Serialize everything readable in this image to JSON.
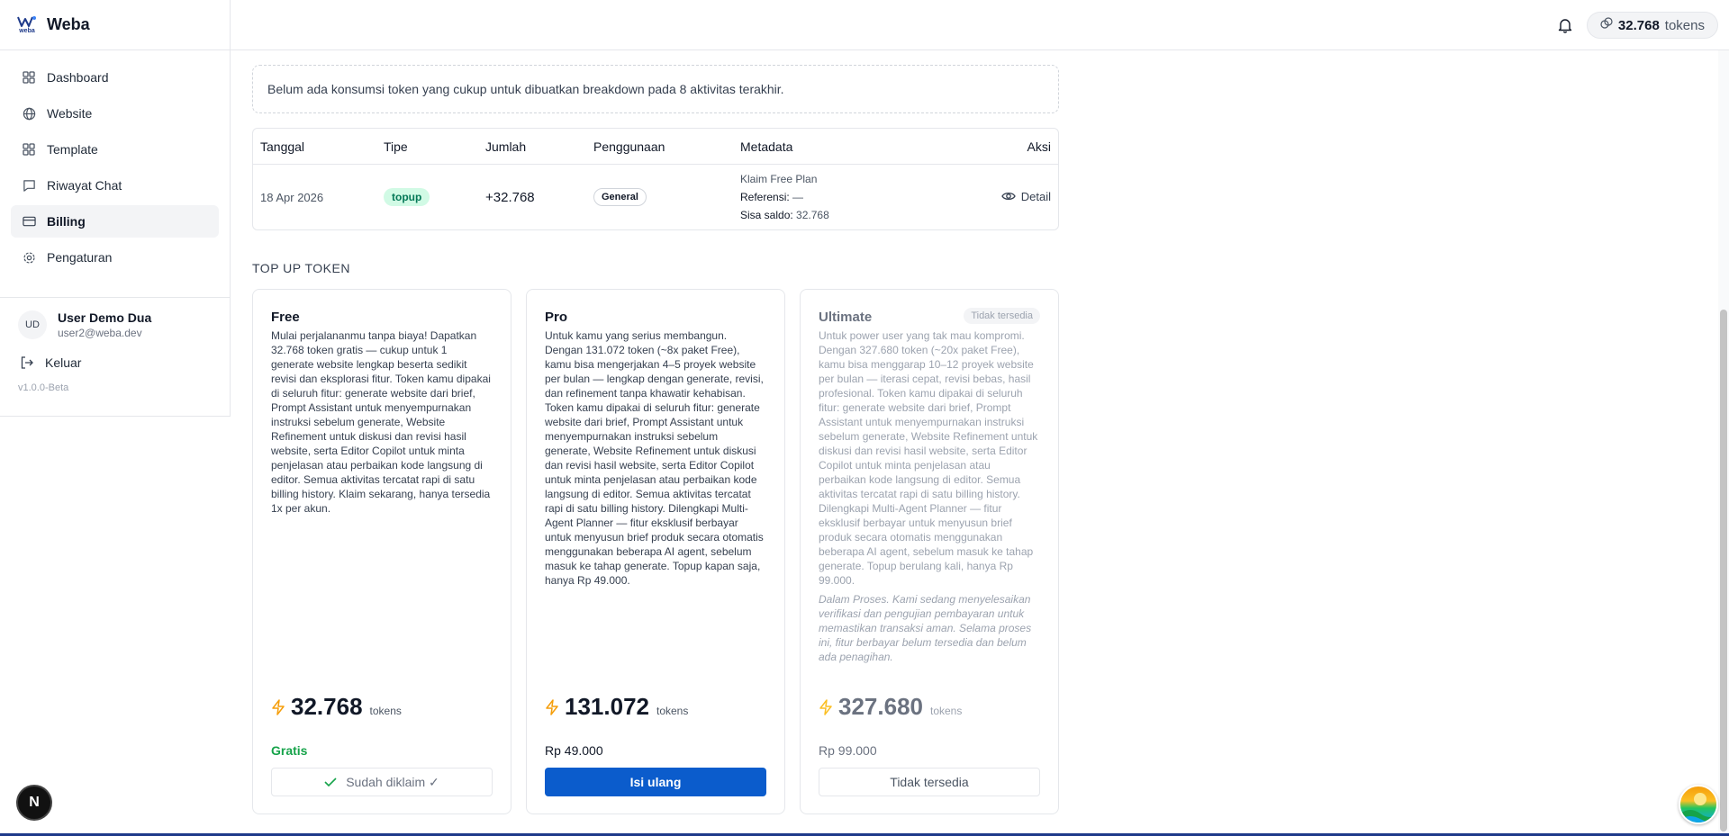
{
  "brand": {
    "name": "Weba",
    "logo_text": "weba"
  },
  "nav": [
    {
      "label": "Dashboard",
      "icon": "grid-icon"
    },
    {
      "label": "Website",
      "icon": "globe-icon"
    },
    {
      "label": "Template",
      "icon": "grid-icon"
    },
    {
      "label": "Riwayat Chat",
      "icon": "chat-icon"
    },
    {
      "label": "Billing",
      "icon": "card-icon",
      "active": true
    },
    {
      "label": "Pengaturan",
      "icon": "gear-icon"
    }
  ],
  "user": {
    "initials": "UD",
    "name": "User Demo Dua",
    "email": "user2@weba.dev"
  },
  "logout_label": "Keluar",
  "version": "v1.0.0-Beta",
  "header": {
    "token_amount": "32.768",
    "token_unit": "tokens"
  },
  "empty_note": "Belum ada konsumsi token yang cukup untuk dibuatkan breakdown pada 8 aktivitas terakhir.",
  "table": {
    "headers": [
      "Tanggal",
      "Tipe",
      "Jumlah",
      "Penggunaan",
      "Metadata",
      "Aksi"
    ],
    "rows": [
      {
        "date": "18 Apr 2026",
        "type": "topup",
        "amount": "+32.768",
        "usage": "General",
        "meta_title": "Klaim Free Plan",
        "meta_ref_label": "Referensi:",
        "meta_ref_value": "—",
        "meta_balance_label": "Sisa saldo:",
        "meta_balance_value": "32.768",
        "action": "Detail"
      }
    ]
  },
  "section_title": "TOP UP TOKEN",
  "plans": [
    {
      "title": "Free",
      "desc": "Mulai perjalananmu tanpa biaya! Dapatkan 32.768 token gratis — cukup untuk 1 generate website lengkap beserta sedikit revisi dan eksplorasi fitur. Token kamu dipakai di seluruh fitur: generate website dari brief, Prompt Assistant untuk menyempurnakan instruksi sebelum generate, Website Refinement untuk diskusi dan revisi hasil website, serta Editor Copilot untuk minta penjelasan atau perbaikan kode langsung di editor. Semua aktivitas tercatat rapi di satu billing history. Klaim sekarang, hanya tersedia 1x per akun.",
      "tokens": "32.768",
      "unit": "tokens",
      "price": "Gratis",
      "button": "Sudah diklaim ✓"
    },
    {
      "title": "Pro",
      "desc": "Untuk kamu yang serius membangun. Dengan 131.072 token (~8x paket Free), kamu bisa mengerjakan 4–5 proyek website per bulan — lengkap dengan generate, revisi, dan refinement tanpa khawatir kehabisan. Token kamu dipakai di seluruh fitur: generate website dari brief, Prompt Assistant untuk menyempurnakan instruksi sebelum generate, Website Refinement untuk diskusi dan revisi hasil website, serta Editor Copilot untuk minta penjelasan atau perbaikan kode langsung di editor. Semua aktivitas tercatat rapi di satu billing history. Dilengkapi Multi-Agent Planner — fitur eksklusif berbayar untuk menyusun brief produk secara otomatis menggunakan beberapa AI agent, sebelum masuk ke tahap generate. Topup kapan saja, hanya Rp 49.000.",
      "tokens": "131.072",
      "unit": "tokens",
      "price": "Rp 49.000",
      "button": "Isi ulang"
    },
    {
      "title": "Ultimate",
      "badge": "Tidak tersedia",
      "desc": "Untuk power user yang tak mau kompromi. Dengan 327.680 token (~20x paket Free), kamu bisa menggarap 10–12 proyek website per bulan — iterasi cepat, revisi bebas, hasil profesional. Token kamu dipakai di seluruh fitur: generate website dari brief, Prompt Assistant untuk menyempurnakan instruksi sebelum generate, Website Refinement untuk diskusi dan revisi hasil website, serta Editor Copilot untuk minta penjelasan atau perbaikan kode langsung di editor. Semua aktivitas tercatat rapi di satu billing history. Dilengkapi Multi-Agent Planner — fitur eksklusif berbayar untuk menyusun brief produk secara otomatis menggunakan beberapa AI agent, sebelum masuk ke tahap generate. Topup berulang kali, hanya Rp 99.000.",
      "note": "Dalam Proses. Kami sedang menyelesaikan verifikasi dan pengujian pembayaran untuk memastikan transaksi aman. Selama proses ini, fitur berbayar belum tersedia dan belum ada penagihan.",
      "tokens": "327.680",
      "unit": "tokens",
      "price": "Rp 99.000",
      "button": "Tidak tersedia"
    }
  ],
  "next_badge": "N",
  "colors": {
    "primary": "#0b5ccc",
    "success": "#16a34a",
    "topup_bg": "#d1fae5",
    "bolt": "#f59e0b"
  }
}
